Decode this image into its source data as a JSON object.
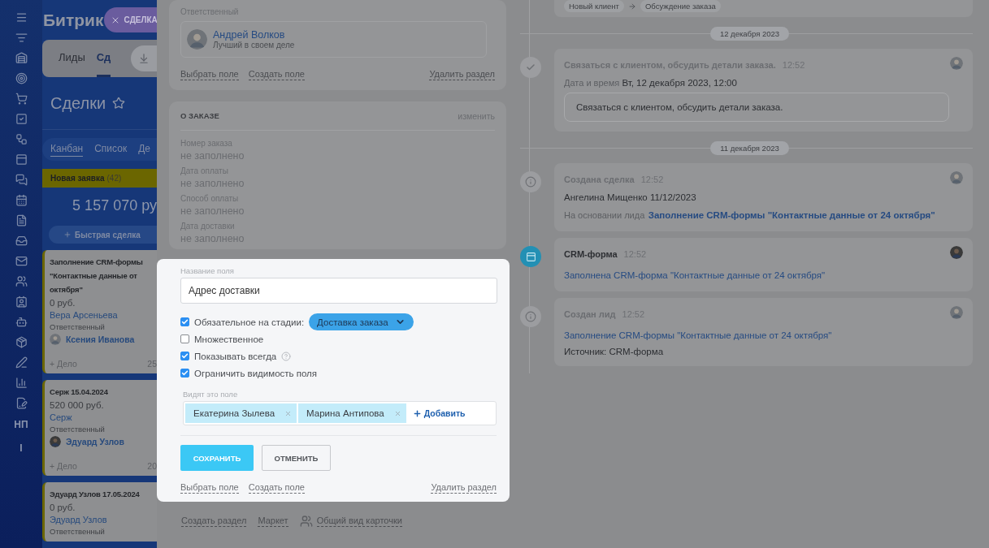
{
  "sidebar": {
    "text_items": [
      "НП",
      "I"
    ]
  },
  "kanban": {
    "title": "Битрик",
    "slider_tab": "СДЕЛКА",
    "tabs": [
      {
        "label": "Лиды",
        "selected": false
      },
      {
        "label": "Сд",
        "selected": true
      }
    ],
    "page_title": "Сделки",
    "views": [
      {
        "label": "Канбан",
        "selected": true
      },
      {
        "label": "Список",
        "selected": false
      },
      {
        "label": "Де",
        "selected": false
      }
    ],
    "column": {
      "name": "Новая заявка",
      "count": "(42)",
      "total": "5 157 070 ру",
      "quick_add": "Быстрая сделка"
    },
    "cards": [
      {
        "title_lines": [
          "Заполнение CRM-формы",
          "\"Контактные данные от",
          "октября\""
        ],
        "amount": "0 руб.",
        "client": "Вера Арсеньева",
        "responsible_label": "Ответственный",
        "responsible": "Ксения Иванова",
        "activity": "+ Дело",
        "date": "25"
      },
      {
        "title_lines": [
          "Серж 15.04.2024"
        ],
        "amount": "520 000 руб.",
        "client": "Серж",
        "responsible_label": "Ответственный",
        "responsible": "Эдуард Узлов",
        "activity": "+ Дело",
        "date": "20"
      },
      {
        "title_lines": [
          "Эдуард Узлов 17.05.2024"
        ],
        "amount": "0 руб.",
        "client": "Эдуард Узлов",
        "responsible_label": "Ответственный"
      }
    ]
  },
  "details": {
    "responsible_section": {
      "label": "Ответственный",
      "name": "Андрей Волков",
      "note": "Лучший в своем деле",
      "links": [
        "Выбрать поле",
        "Создать поле"
      ],
      "delete": "Удалить раздел"
    },
    "order_section": {
      "title": "О ЗАКАЗЕ",
      "edit": "изменить",
      "fields": [
        {
          "label": "Номер заказа",
          "value": "не заполнено"
        },
        {
          "label": "Дата оплаты",
          "value": "не заполнено"
        },
        {
          "label": "Способ оплаты",
          "value": "не заполнено"
        },
        {
          "label": "Дата доставки",
          "value": "не заполнено"
        }
      ]
    },
    "dialog": {
      "name_label": "Название поля",
      "name_value": "Адрес доставки",
      "options": [
        {
          "label": "Обязательное на стадии:",
          "checked": true,
          "stage": "Доставка заказа"
        },
        {
          "label": "Множественное",
          "checked": false
        },
        {
          "label": "Показывать всегда",
          "checked": true,
          "help": true
        },
        {
          "label": "Ограничить видимость поля",
          "checked": true
        }
      ],
      "visible_label": "Видят это поле",
      "visible_to": [
        "Екатерина Зылева",
        "Марина Антипова"
      ],
      "add": "Добавить",
      "save": "СОХРАНИТЬ",
      "cancel": "ОТМЕНИТЬ",
      "links": [
        "Выбрать поле",
        "Создать поле"
      ],
      "delete": "Удалить раздел"
    },
    "footer_links": [
      "Создать раздел",
      "Маркет"
    ],
    "card_view": "Общий вид карточки"
  },
  "timeline": {
    "stage_change": {
      "from": "Новый клиент",
      "to": "Обсуждение заказа"
    },
    "entries": [
      {
        "kind": "date",
        "label": "12 декабря 2023"
      },
      {
        "kind": "task",
        "title": "Связаться с клиентом, обсудить детали заказа.",
        "time": "12:52",
        "meta_label": "Дата и время",
        "meta_value": "Вт, 12 декабря 2023, 12:00",
        "comment": "Связаться с клиентом, обсудить детали заказа."
      },
      {
        "kind": "date",
        "label": "11 декабря 2023"
      },
      {
        "kind": "info",
        "title": "Создана сделка",
        "time": "12:52",
        "lines": [
          {
            "text": "Ангелина Мищенко 11/12/2023"
          },
          {
            "prefix": "На основании лида",
            "link": "Заполнение CRM-формы \"Контактные данные от 24 октября\""
          }
        ]
      },
      {
        "kind": "form",
        "title": "CRM-форма",
        "time": "12:52",
        "lines": [
          {
            "link": "Заполнена CRM-форма \"Контактные данные от 24 октября\""
          }
        ]
      },
      {
        "kind": "info",
        "title": "Создан лид",
        "time": "12:52",
        "lines": [
          {
            "link": "Заполнение CRM-формы \"Контактные данные от 24 октября\""
          },
          {
            "text": "Источник: CRM-форма"
          }
        ]
      }
    ]
  }
}
